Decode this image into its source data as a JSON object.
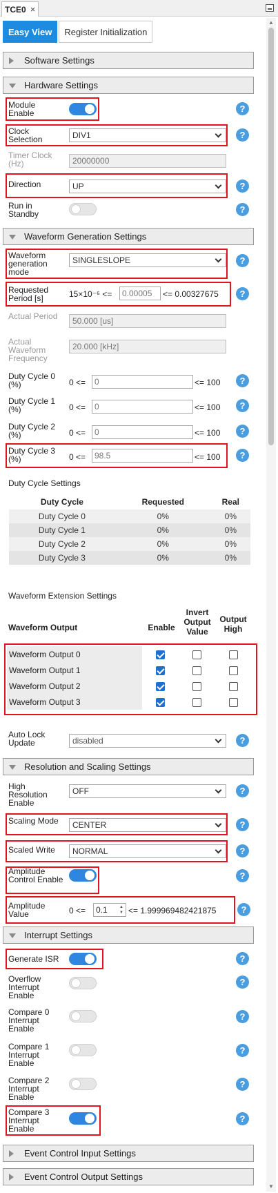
{
  "tab": {
    "title": "TCE0",
    "close": "×"
  },
  "subtabs": [
    "Easy View",
    "Register Initialization"
  ],
  "sections": {
    "software": "Software Settings",
    "hardware": "Hardware Settings",
    "waveform": "Waveform Generation Settings",
    "resolution": "Resolution and Scaling Settings",
    "interrupt": "Interrupt Settings",
    "event_in": "Event Control Input Settings",
    "event_out": "Event Control Output Settings"
  },
  "hardware": {
    "module_enable": {
      "label": "Module Enable",
      "on": true
    },
    "clock_selection": {
      "label": "Clock Selection",
      "value": "DIV1"
    },
    "timer_clock": {
      "label": "Timer Clock (Hz)",
      "value": "20000000"
    },
    "direction": {
      "label": "Direction",
      "value": "UP"
    },
    "run_in_standby": {
      "label": "Run in Standby",
      "on": false
    }
  },
  "waveform": {
    "mode": {
      "label": "Waveform generation mode",
      "value": "SINGLESLOPE"
    },
    "requested_period": {
      "label": "Requested Period [s]",
      "min": "15×10⁻⁶ <=",
      "value": "0.00005",
      "max": "<= 0.00327675"
    },
    "actual_period": {
      "label": "Actual Period",
      "value": "50.000 [us]"
    },
    "actual_freq": {
      "label": "Actual Waveform Frequency",
      "value": "20.000 [kHz]"
    },
    "duty": [
      {
        "label": "Duty Cycle 0 (%)",
        "min": "0 <=",
        "value": "0",
        "max": "<= 100"
      },
      {
        "label": "Duty Cycle 1 (%)",
        "min": "0 <=",
        "value": "0",
        "max": "<= 100"
      },
      {
        "label": "Duty Cycle 2 (%)",
        "min": "0 <=",
        "value": "0",
        "max": "<= 100"
      },
      {
        "label": "Duty Cycle 3 (%)",
        "min": "0 <=",
        "value": "98.5",
        "max": "<= 100"
      }
    ],
    "duty_settings_title": "Duty Cycle Settings",
    "duty_table": {
      "headers": [
        "Duty Cycle",
        "Requested",
        "Real"
      ],
      "rows": [
        [
          "Duty Cycle 0",
          "0%",
          "0%"
        ],
        [
          "Duty Cycle 1",
          "0%",
          "0%"
        ],
        [
          "Duty Cycle 2",
          "0%",
          "0%"
        ],
        [
          "Duty Cycle 3",
          "0%",
          "0%"
        ]
      ]
    },
    "extension_title": "Waveform Extension Settings",
    "output_table": {
      "headers": [
        "Waveform Output",
        "Enable",
        "Invert Output Value",
        "Output High"
      ],
      "rows": [
        {
          "name": "Waveform Output 0",
          "enable": true,
          "invert": false,
          "high": false
        },
        {
          "name": "Waveform Output 1",
          "enable": true,
          "invert": false,
          "high": false
        },
        {
          "name": "Waveform Output 2",
          "enable": true,
          "invert": false,
          "high": false
        },
        {
          "name": "Waveform Output 3",
          "enable": true,
          "invert": false,
          "high": false
        }
      ]
    },
    "auto_lock": {
      "label": "Auto Lock Update",
      "value": "disabled"
    }
  },
  "resolution": {
    "high_res": {
      "label": "High Resolution Enable",
      "value": "OFF"
    },
    "scaling_mode": {
      "label": "Scaling Mode",
      "value": "CENTER"
    },
    "scaled_write": {
      "label": "Scaled Write",
      "value": "NORMAL"
    },
    "amplitude_control": {
      "label": "Amplitude Control Enable",
      "on": true
    },
    "amplitude_value": {
      "label": "Amplitude Value",
      "min": "0 <=",
      "value": "0.1",
      "max": "<= 1.999969482421875"
    }
  },
  "interrupt": {
    "generate_isr": {
      "label": "Generate ISR",
      "on": true
    },
    "overflow": {
      "label": "Overflow Interrupt Enable",
      "on": false
    },
    "compare0": {
      "label": "Compare 0 Interrupt Enable",
      "on": false
    },
    "compare1": {
      "label": "Compare 1 Interrupt Enable",
      "on": false
    },
    "compare2": {
      "label": "Compare 2 Interrupt Enable",
      "on": false
    },
    "compare3": {
      "label": "Compare 3 Interrupt Enable",
      "on": true
    }
  },
  "help_glyph": "?"
}
